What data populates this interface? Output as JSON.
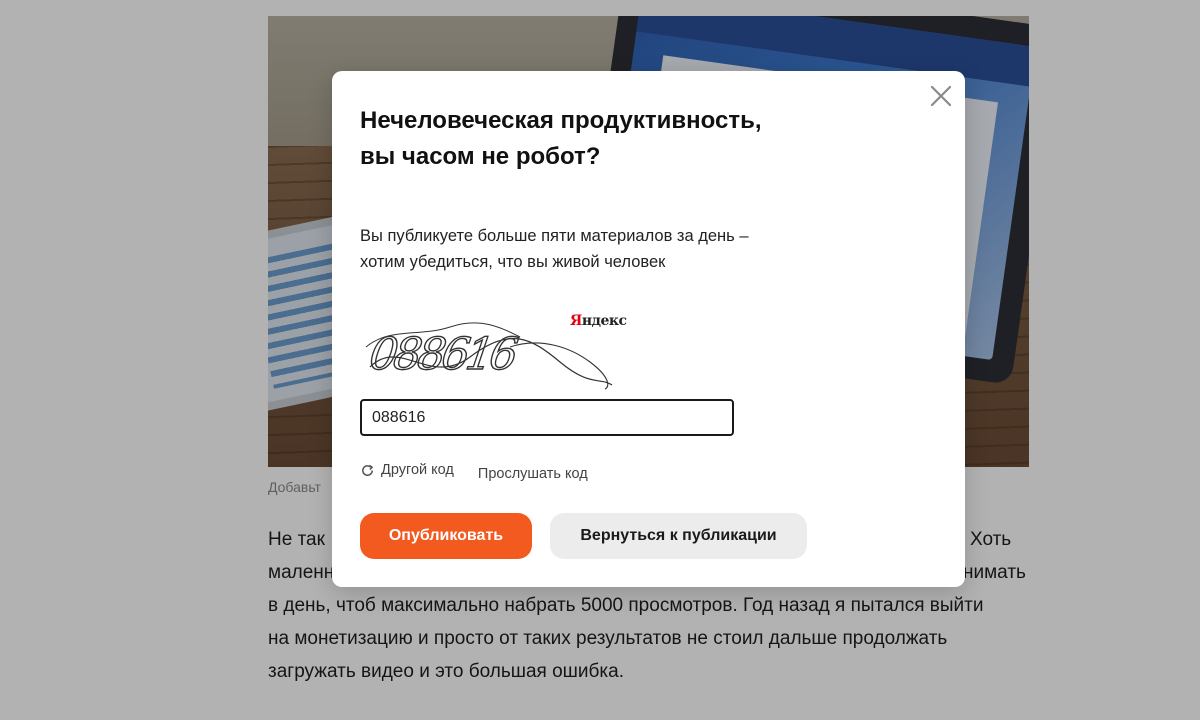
{
  "article": {
    "caption": "Добавьт",
    "lines": [
      {
        "left": "Не так",
        "right": "Хоть"
      },
      {
        "left": "маленн",
        "right": "нимать"
      },
      {
        "left": "в день, чтоб максимально набрать 5000 просмотров. Год назад я пытался выйти",
        "right": ""
      },
      {
        "left": "на монетизацию и просто от таких результатов не стоил дальше продолжать",
        "right": ""
      },
      {
        "left": "загружать видео и это большая ошибка.",
        "right": ""
      }
    ]
  },
  "modal": {
    "title": "Нечеловеческая продуктивность, вы часом не робот?",
    "text": "Вы публикуете больше пяти материалов за день – хотим убедиться, что вы живой человек",
    "captcha": {
      "brand_letter": "Я",
      "brand_rest": "ндекс",
      "digits": "088616"
    },
    "input_value": "088616",
    "links": {
      "other_code": "Другой код",
      "listen_code": "Прослушать код"
    },
    "buttons": {
      "publish": "Опубликовать",
      "back": "Вернуться к публикации"
    },
    "colors": {
      "accent": "#f25a1f",
      "secondary": "#ececec",
      "overlay": "rgba(0,0,0,0.30)"
    },
    "icons": {
      "close": "close-icon",
      "refresh": "refresh-icon"
    }
  }
}
